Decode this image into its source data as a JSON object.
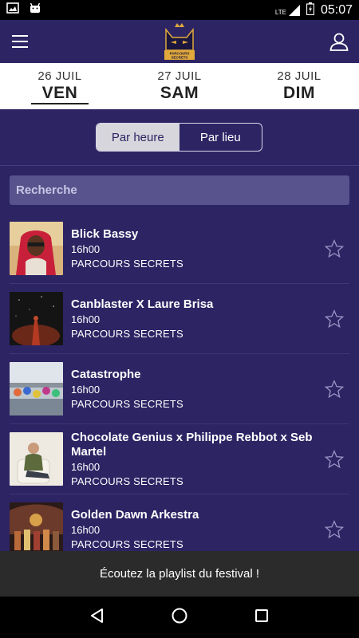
{
  "statusbar": {
    "time": "05:07",
    "network": "LTE",
    "left_icons": [
      "gallery-icon",
      "android-icon"
    ]
  },
  "appbar": {
    "menu_icon": "hamburger-icon",
    "logo": "cat-logo-icon",
    "logo_text": "PARCOURS SECRETS",
    "profile_icon": "user-icon"
  },
  "days": [
    {
      "date": "26 JUIL",
      "day": "VEN",
      "active": true
    },
    {
      "date": "27 JUIL",
      "day": "SAM",
      "active": false
    },
    {
      "date": "28 JUIL",
      "day": "DIM",
      "active": false
    }
  ],
  "segment": {
    "by_time": "Par heure",
    "by_place": "Par lieu",
    "selected": "Par heure"
  },
  "search": {
    "placeholder": "Recherche"
  },
  "events": [
    {
      "title": "Blick Bassy",
      "time": "16h00",
      "venue": "PARCOURS SECRETS",
      "favorite": false
    },
    {
      "title": "Canblaster X Laure Brisa",
      "time": "16h00",
      "venue": "PARCOURS SECRETS",
      "favorite": false
    },
    {
      "title": "Catastrophe",
      "time": "16h00",
      "venue": "PARCOURS SECRETS",
      "favorite": false
    },
    {
      "title": "Chocolate Genius x Philippe Rebbot x Seb Martel",
      "time": "16h00",
      "venue": "PARCOURS SECRETS",
      "favorite": false
    },
    {
      "title": "Golden Dawn Arkestra",
      "time": "16h00",
      "venue": "PARCOURS SECRETS",
      "favorite": false
    }
  ],
  "banner": {
    "text": "Écoutez la playlist du festival !"
  },
  "colors": {
    "background": "#2d2464",
    "accent_gold": "#e0a93a",
    "search_bg": "#59538d",
    "banner_bg": "#2b2b2b"
  }
}
